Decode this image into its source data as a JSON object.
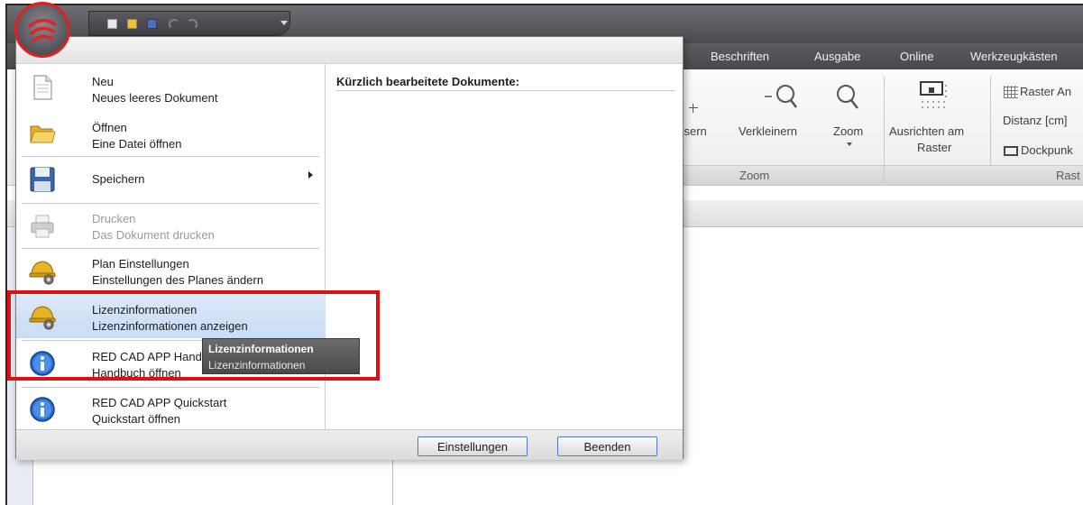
{
  "tabs": [
    "Beschriften",
    "Ausgabe",
    "Online",
    "Werkzeugkästen"
  ],
  "ribbon": {
    "vergroessern_partial": "ssern",
    "verkleinern": "Verkleinern",
    "zoom": "Zoom",
    "ausrichten_line1": "Ausrichten am",
    "ausrichten_line2": "Raster",
    "raster_an": "Raster An",
    "distanz": "Distanz [cm]",
    "dockpunkt": "Dockpunk",
    "group_zoom": "Zoom",
    "group_raster": "Rast"
  },
  "menu": {
    "items": [
      {
        "title": "Neu",
        "subtitle": "Neues leeres Dokument",
        "icon": "new-document-icon"
      },
      {
        "title": "Öffnen",
        "subtitle": "Eine Datei öffnen",
        "icon": "folder-icon"
      },
      {
        "title": "Speichern",
        "subtitle": "",
        "icon": "floppy-disk-icon"
      },
      {
        "title": "Drucken",
        "subtitle": "Das Dokument drucken",
        "icon": "printer-icon"
      },
      {
        "title": "Plan Einstellungen",
        "subtitle": "Einstellungen des Planes ändern",
        "icon": "hardhat-icon"
      },
      {
        "title": "Lizenzinformationen",
        "subtitle": "Lizenzinformationen anzeigen",
        "icon": "hardhat-icon"
      },
      {
        "title": "RED CAD APP Handbuch",
        "subtitle": "Handbuch öffnen",
        "icon": "info-icon"
      },
      {
        "title": "RED CAD APP Quickstart",
        "subtitle": "Quickstart öffnen",
        "icon": "info-icon"
      }
    ],
    "recent_title": "Kürzlich bearbeitete Dokumente:",
    "settings_button": "Einstellungen",
    "exit_button": "Beenden"
  },
  "tooltip": {
    "title": "Lizenzinformationen",
    "text": "Lizenzinformationen"
  },
  "colors": {
    "highlight": "#e01010",
    "hover": "#c8dcf5",
    "accent_button": "#4f7bd0"
  }
}
